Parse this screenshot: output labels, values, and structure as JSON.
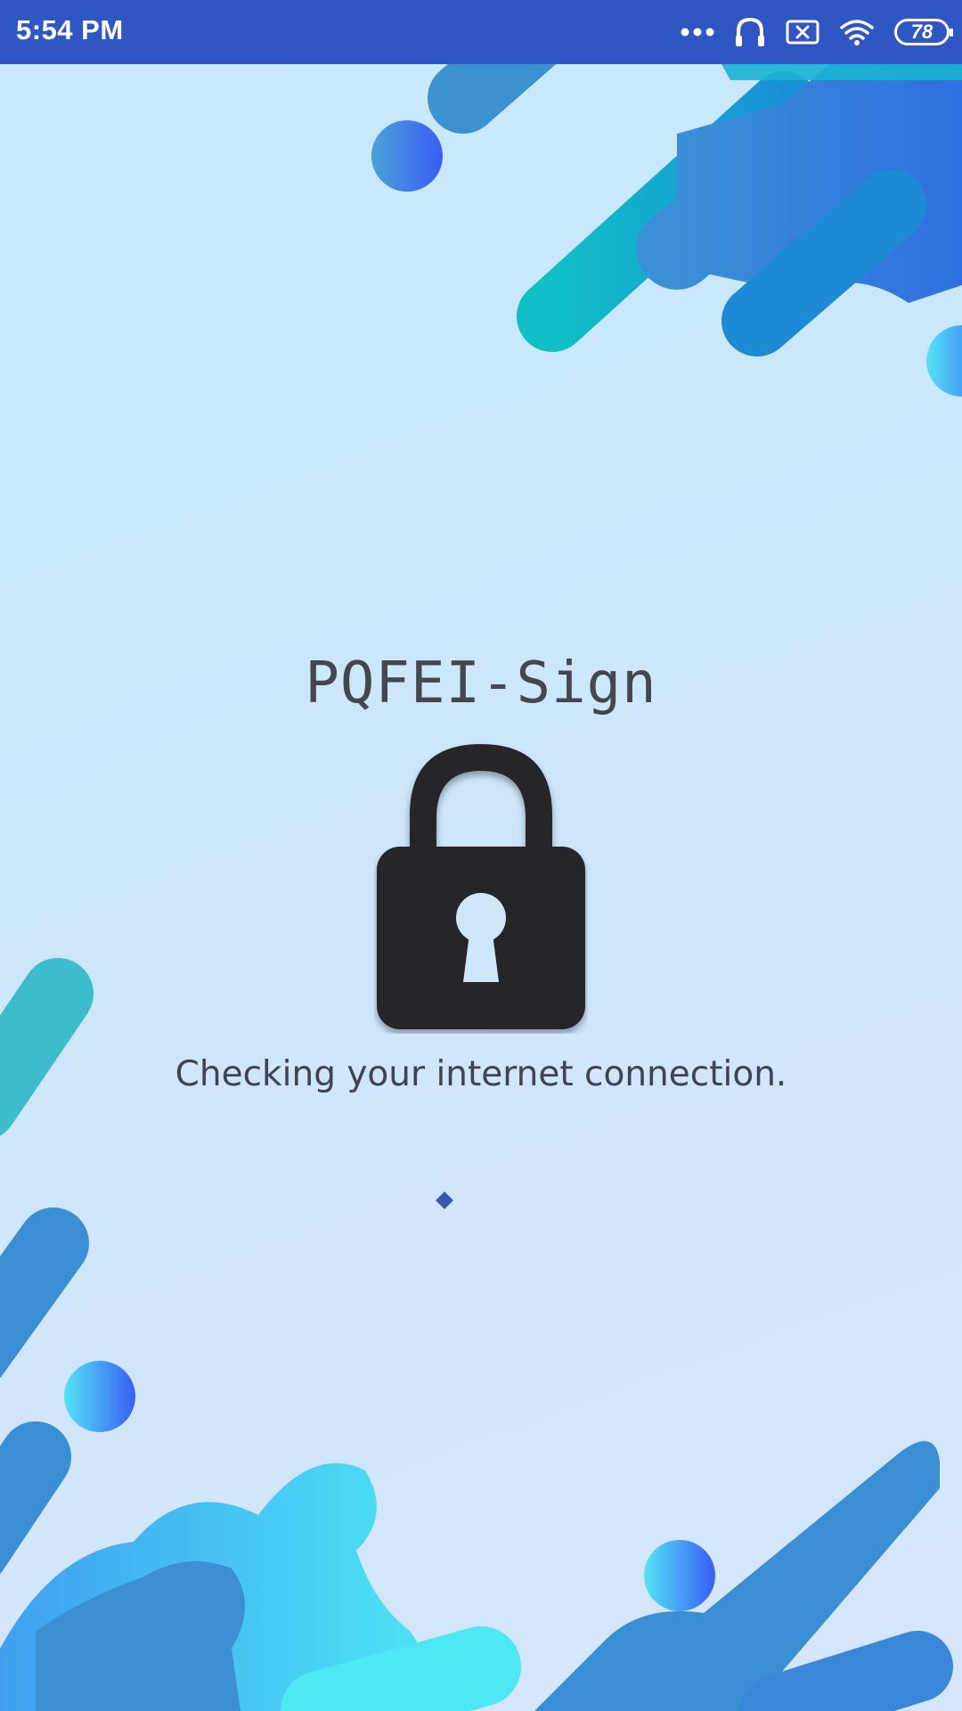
{
  "status_bar": {
    "time": "5:54 PM",
    "battery_level": "78",
    "icons": [
      "more-dots-icon",
      "headphones-icon",
      "sim-missing-icon",
      "wifi-icon",
      "battery-icon"
    ]
  },
  "app": {
    "title": "PQFEI-Sign",
    "status_message": "Checking your internet connection.",
    "center_icon": "padlock-icon",
    "loading_indicator": "spinner"
  },
  "colors": {
    "status_bar": "#2f56c3",
    "title_text": "#444650",
    "lock": "#27282c",
    "background": "#c9e8fb",
    "spinner": "#3a56b3"
  }
}
